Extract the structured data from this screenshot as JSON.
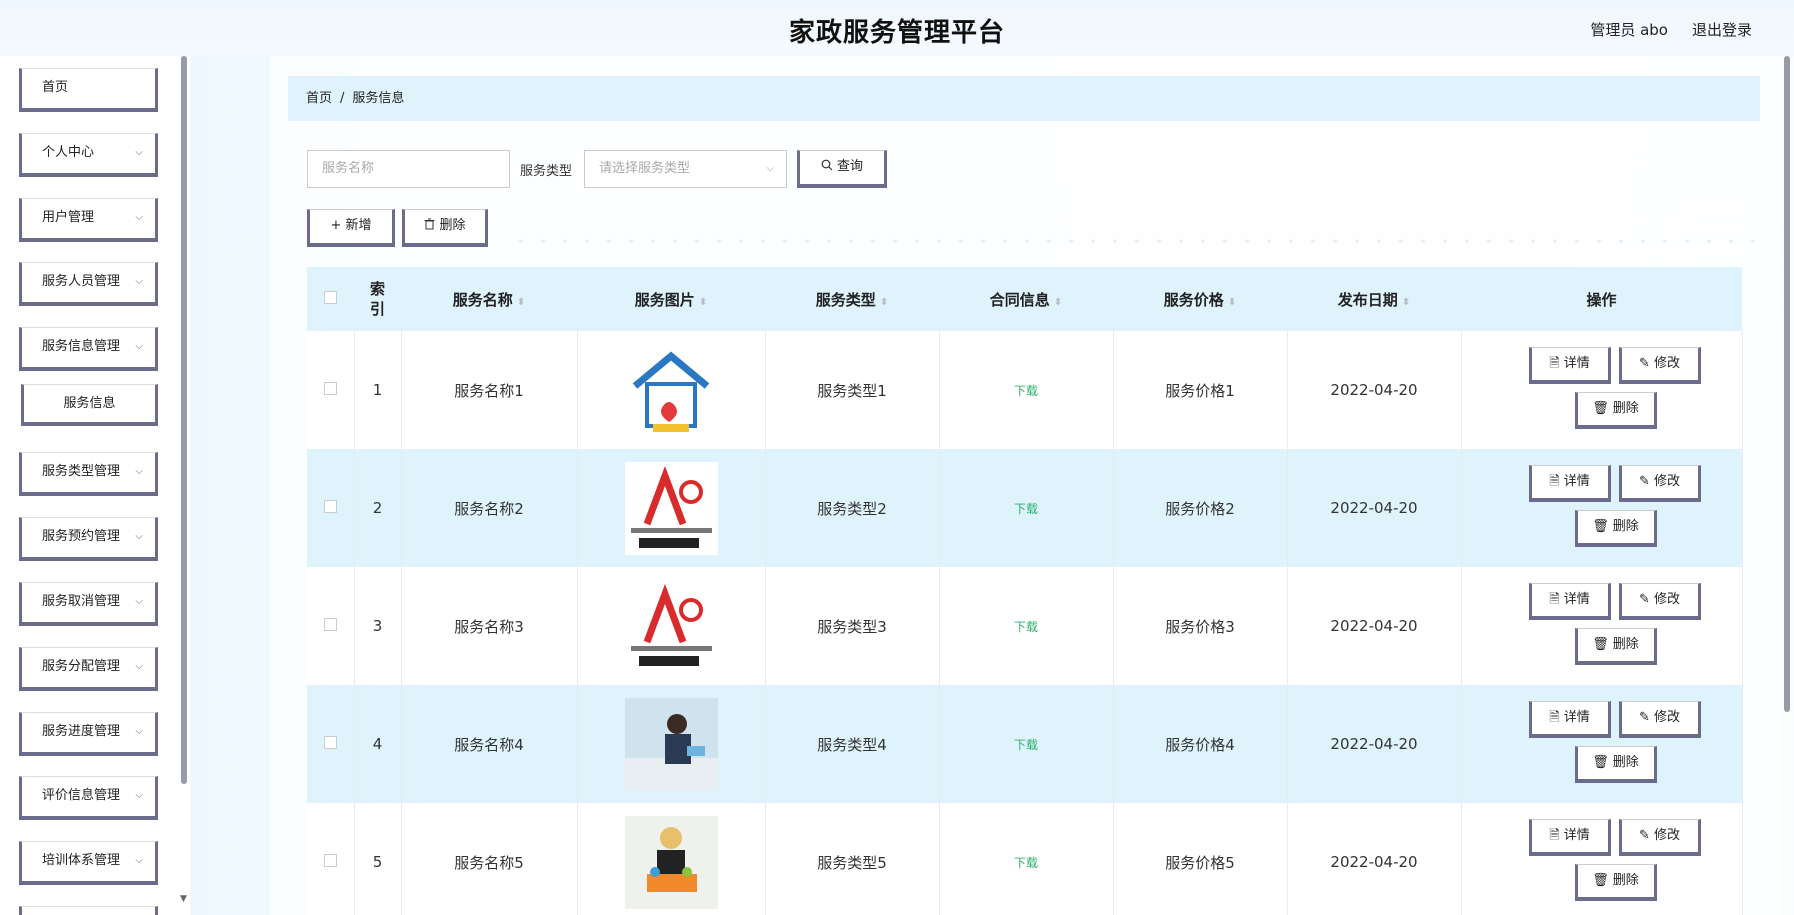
{
  "header": {
    "title": "家政服务管理平台",
    "user": "管理员 abo",
    "logout": "退出登录"
  },
  "sidebar": {
    "items": [
      {
        "label": "首页",
        "chev": ""
      },
      {
        "label": "个人中心",
        "chev": "⌵"
      },
      {
        "label": "用户管理",
        "chev": "⌵"
      },
      {
        "label": "服务人员管理",
        "chev": "⌵"
      },
      {
        "label": "服务信息管理",
        "chev": "⌵"
      },
      {
        "label": "服务信息",
        "chev": ""
      },
      {
        "label": "服务类型管理",
        "chev": "⌵"
      },
      {
        "label": "服务预约管理",
        "chev": "⌵"
      },
      {
        "label": "服务取消管理",
        "chev": "⌵"
      },
      {
        "label": "服务分配管理",
        "chev": "⌵"
      },
      {
        "label": "服务进度管理",
        "chev": "⌵"
      },
      {
        "label": "评价信息管理",
        "chev": "⌵"
      },
      {
        "label": "培训体系管理",
        "chev": "⌵"
      }
    ]
  },
  "breadcrumb": {
    "home": "首页",
    "sep": "/",
    "current": "服务信息"
  },
  "search": {
    "name_placeholder": "服务名称",
    "type_label": "服务类型",
    "type_placeholder": "请选择服务类型",
    "query_label": "查询",
    "add_label": "新增",
    "delete_label": "删除"
  },
  "icons": {
    "query": "search-icon",
    "add": "plus-icon",
    "delete": "trash-icon",
    "detail": "document-icon",
    "edit": "pencil-icon"
  },
  "table": {
    "headers": [
      "索引",
      "服务名称",
      "服务图片",
      "服务类型",
      "合同信息",
      "服务价格",
      "发布日期",
      "操作"
    ],
    "rows": [
      {
        "index": "1",
        "name": "服务名称1",
        "type": "服务类型1",
        "contract": "下载",
        "price": "服务价格1",
        "date": "2022-04-20"
      },
      {
        "index": "2",
        "name": "服务名称2",
        "type": "服务类型2",
        "contract": "下载",
        "price": "服务价格2",
        "date": "2022-04-20"
      },
      {
        "index": "3",
        "name": "服务名称3",
        "type": "服务类型3",
        "contract": "下载",
        "price": "服务价格3",
        "date": "2022-04-20"
      },
      {
        "index": "4",
        "name": "服务名称4",
        "type": "服务类型4",
        "contract": "下载",
        "price": "服务价格4",
        "date": "2022-04-20"
      },
      {
        "index": "5",
        "name": "服务名称5",
        "type": "服务类型5",
        "contract": "下载",
        "price": "服务价格5",
        "date": "2022-04-20"
      }
    ],
    "op_detail": "详情",
    "op_edit": "修改",
    "op_delete": "删除"
  },
  "colors": {
    "accent_bg": "#dff3fd",
    "border_dark": "#6b6b8c",
    "download_green": "#2bb06b"
  }
}
